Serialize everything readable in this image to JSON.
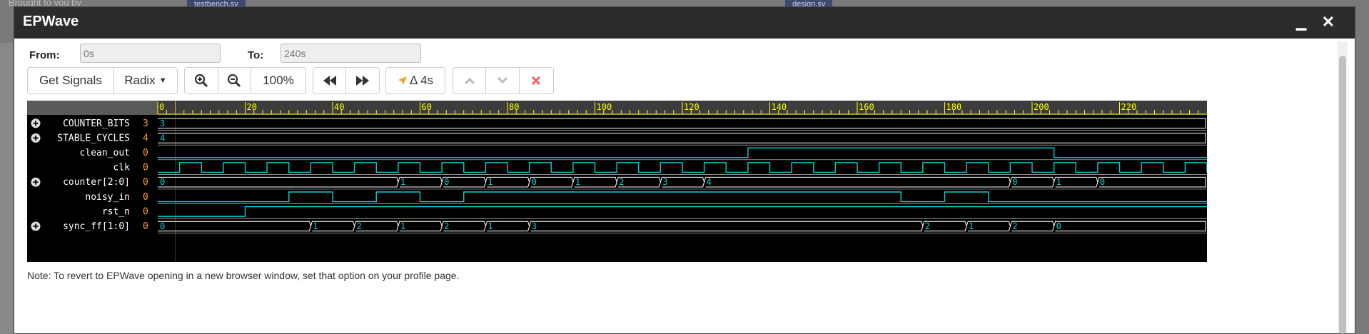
{
  "background": {
    "tabs": [
      "testbench.sv",
      "design.sv"
    ],
    "text": "Brought to you by"
  },
  "window": {
    "title": "EPWave",
    "minimize_glyph": "▁",
    "close_glyph": "✕"
  },
  "range": {
    "from_label": "From:",
    "from_value": "0s",
    "to_label": "To:",
    "to_value": "240s"
  },
  "toolbar": {
    "get_signals": "Get Signals",
    "radix": "Radix",
    "zoom_level": "100%",
    "delta": "Δ 4s",
    "icons": [
      "zoom-in-icon",
      "zoom-out-icon",
      "rewind-icon",
      "fast-forward-icon",
      "cursor-icon",
      "chevron-up-icon",
      "chevron-down-icon",
      "delete-icon"
    ]
  },
  "waveform": {
    "time_ticks": [
      "0",
      "20",
      "40",
      "60",
      "80",
      "100",
      "120",
      "140",
      "160",
      "180",
      "200",
      "220"
    ],
    "time_range": [
      0,
      240
    ],
    "colors": {
      "wave": "#00d4d4",
      "value": "#ff9933",
      "ruler": "#ffff00",
      "name": "#ffffff"
    },
    "signals": [
      {
        "name": "COUNTER_BITS",
        "value": "3",
        "expandable": true,
        "type": "bus",
        "segments": [
          {
            "t": 0,
            "v": "3"
          }
        ]
      },
      {
        "name": "STABLE_CYCLES",
        "value": "4",
        "expandable": true,
        "type": "bus",
        "segments": [
          {
            "t": 0,
            "v": "4"
          }
        ]
      },
      {
        "name": "clean_out",
        "value": "0",
        "expandable": false,
        "type": "bit",
        "edges": [
          [
            0,
            0
          ],
          [
            135,
            1
          ],
          [
            205,
            0
          ]
        ]
      },
      {
        "name": "clk",
        "value": "0",
        "expandable": false,
        "type": "clock",
        "period": 10
      },
      {
        "name": "counter[2:0]",
        "value": "0",
        "expandable": true,
        "type": "bus",
        "segments": [
          {
            "t": 0,
            "v": "0"
          },
          {
            "t": 55,
            "v": "1"
          },
          {
            "t": 65,
            "v": "0"
          },
          {
            "t": 75,
            "v": "1"
          },
          {
            "t": 85,
            "v": "0"
          },
          {
            "t": 95,
            "v": "1"
          },
          {
            "t": 105,
            "v": "2"
          },
          {
            "t": 115,
            "v": "3"
          },
          {
            "t": 125,
            "v": "4"
          },
          {
            "t": 195,
            "v": "0"
          },
          {
            "t": 205,
            "v": "1"
          },
          {
            "t": 215,
            "v": "0"
          }
        ]
      },
      {
        "name": "noisy_in",
        "value": "0",
        "expandable": false,
        "type": "bit",
        "edges": [
          [
            0,
            0
          ],
          [
            30,
            1
          ],
          [
            40,
            0
          ],
          [
            50,
            1
          ],
          [
            60,
            0
          ],
          [
            70,
            1
          ],
          [
            170,
            0
          ],
          [
            180,
            1
          ],
          [
            190,
            0
          ]
        ]
      },
      {
        "name": "rst_n",
        "value": "0",
        "expandable": false,
        "type": "bit",
        "edges": [
          [
            0,
            0
          ],
          [
            20,
            1
          ]
        ]
      },
      {
        "name": "sync_ff[1:0]",
        "value": "0",
        "expandable": true,
        "type": "bus",
        "segments": [
          {
            "t": 0,
            "v": "0"
          },
          {
            "t": 35,
            "v": "1"
          },
          {
            "t": 45,
            "v": "2"
          },
          {
            "t": 55,
            "v": "1"
          },
          {
            "t": 65,
            "v": "2"
          },
          {
            "t": 75,
            "v": "1"
          },
          {
            "t": 85,
            "v": "3"
          },
          {
            "t": 175,
            "v": "2"
          },
          {
            "t": 185,
            "v": "1"
          },
          {
            "t": 195,
            "v": "2"
          },
          {
            "t": 205,
            "v": "0"
          }
        ]
      }
    ]
  },
  "note": "Note: To revert to EPWave opening in a new browser window, set that option on your profile page."
}
